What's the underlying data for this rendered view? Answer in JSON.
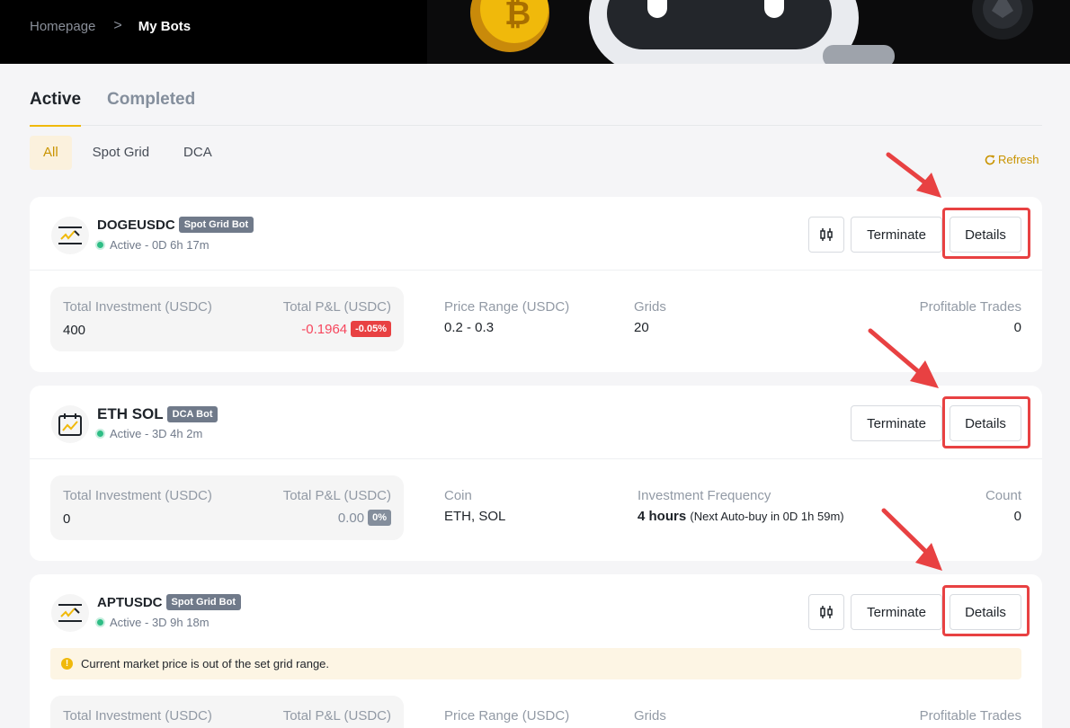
{
  "breadcrumb": {
    "home": "Homepage",
    "separator": ">",
    "current": "My Bots"
  },
  "tabs": [
    {
      "label": "Active",
      "active": true
    },
    {
      "label": "Completed",
      "active": false
    }
  ],
  "filters": [
    {
      "label": "All",
      "active": true
    },
    {
      "label": "Spot Grid",
      "active": false
    },
    {
      "label": "DCA",
      "active": false
    }
  ],
  "refresh_label": "Refresh",
  "colors": {
    "accent": "#f0b90b",
    "accent_text": "#c99400",
    "negative": "#e84142",
    "status_active": "#2ebd85",
    "highlight": "#e84142"
  },
  "bots": [
    {
      "icon": "grid-chart-icon",
      "name": "DOGEUSDC",
      "type": "Spot Grid Bot",
      "status": "Active - 0D 6h 17m",
      "buttons": {
        "terminate": "Terminate",
        "details": "Details"
      },
      "investment_label": "Total Investment (USDC)",
      "investment_value": "400",
      "pnl_label": "Total P&L (USDC)",
      "pnl_value": "-0.1964",
      "pnl_percent": "-0.05%",
      "range_label": "Price Range (USDC)",
      "range_value": "0.2 - 0.3",
      "grids_label": "Grids",
      "grids_value": "20",
      "trades_label": "Profitable Trades",
      "trades_value": "0"
    },
    {
      "icon": "calendar-chart-icon",
      "name": "ETH SOL",
      "type": "DCA Bot",
      "status": "Active - 3D 4h 2m",
      "buttons": {
        "terminate": "Terminate",
        "details": "Details"
      },
      "investment_label": "Total Investment (USDC)",
      "investment_value": "0",
      "pnl_label": "Total P&L (USDC)",
      "pnl_value": "0.00",
      "pnl_percent": "0%",
      "coin_label": "Coin",
      "coin_value": "ETH, SOL",
      "frequency_label": "Investment Frequency",
      "frequency_value": "4 hours",
      "frequency_note": "(Next Auto-buy in 0D 1h 59m)",
      "count_label": "Count",
      "count_value": "0"
    },
    {
      "icon": "grid-chart-icon",
      "name": "APTUSDC",
      "type": "Spot Grid Bot",
      "status": "Active - 3D 9h 18m",
      "buttons": {
        "terminate": "Terminate",
        "details": "Details"
      },
      "warning": "Current market price is out of the set grid range.",
      "investment_label": "Total Investment (USDC)",
      "pnl_label": "Total P&L (USDC)",
      "range_label": "Price Range (USDC)",
      "grids_label": "Grids",
      "trades_label": "Profitable Trades"
    }
  ]
}
